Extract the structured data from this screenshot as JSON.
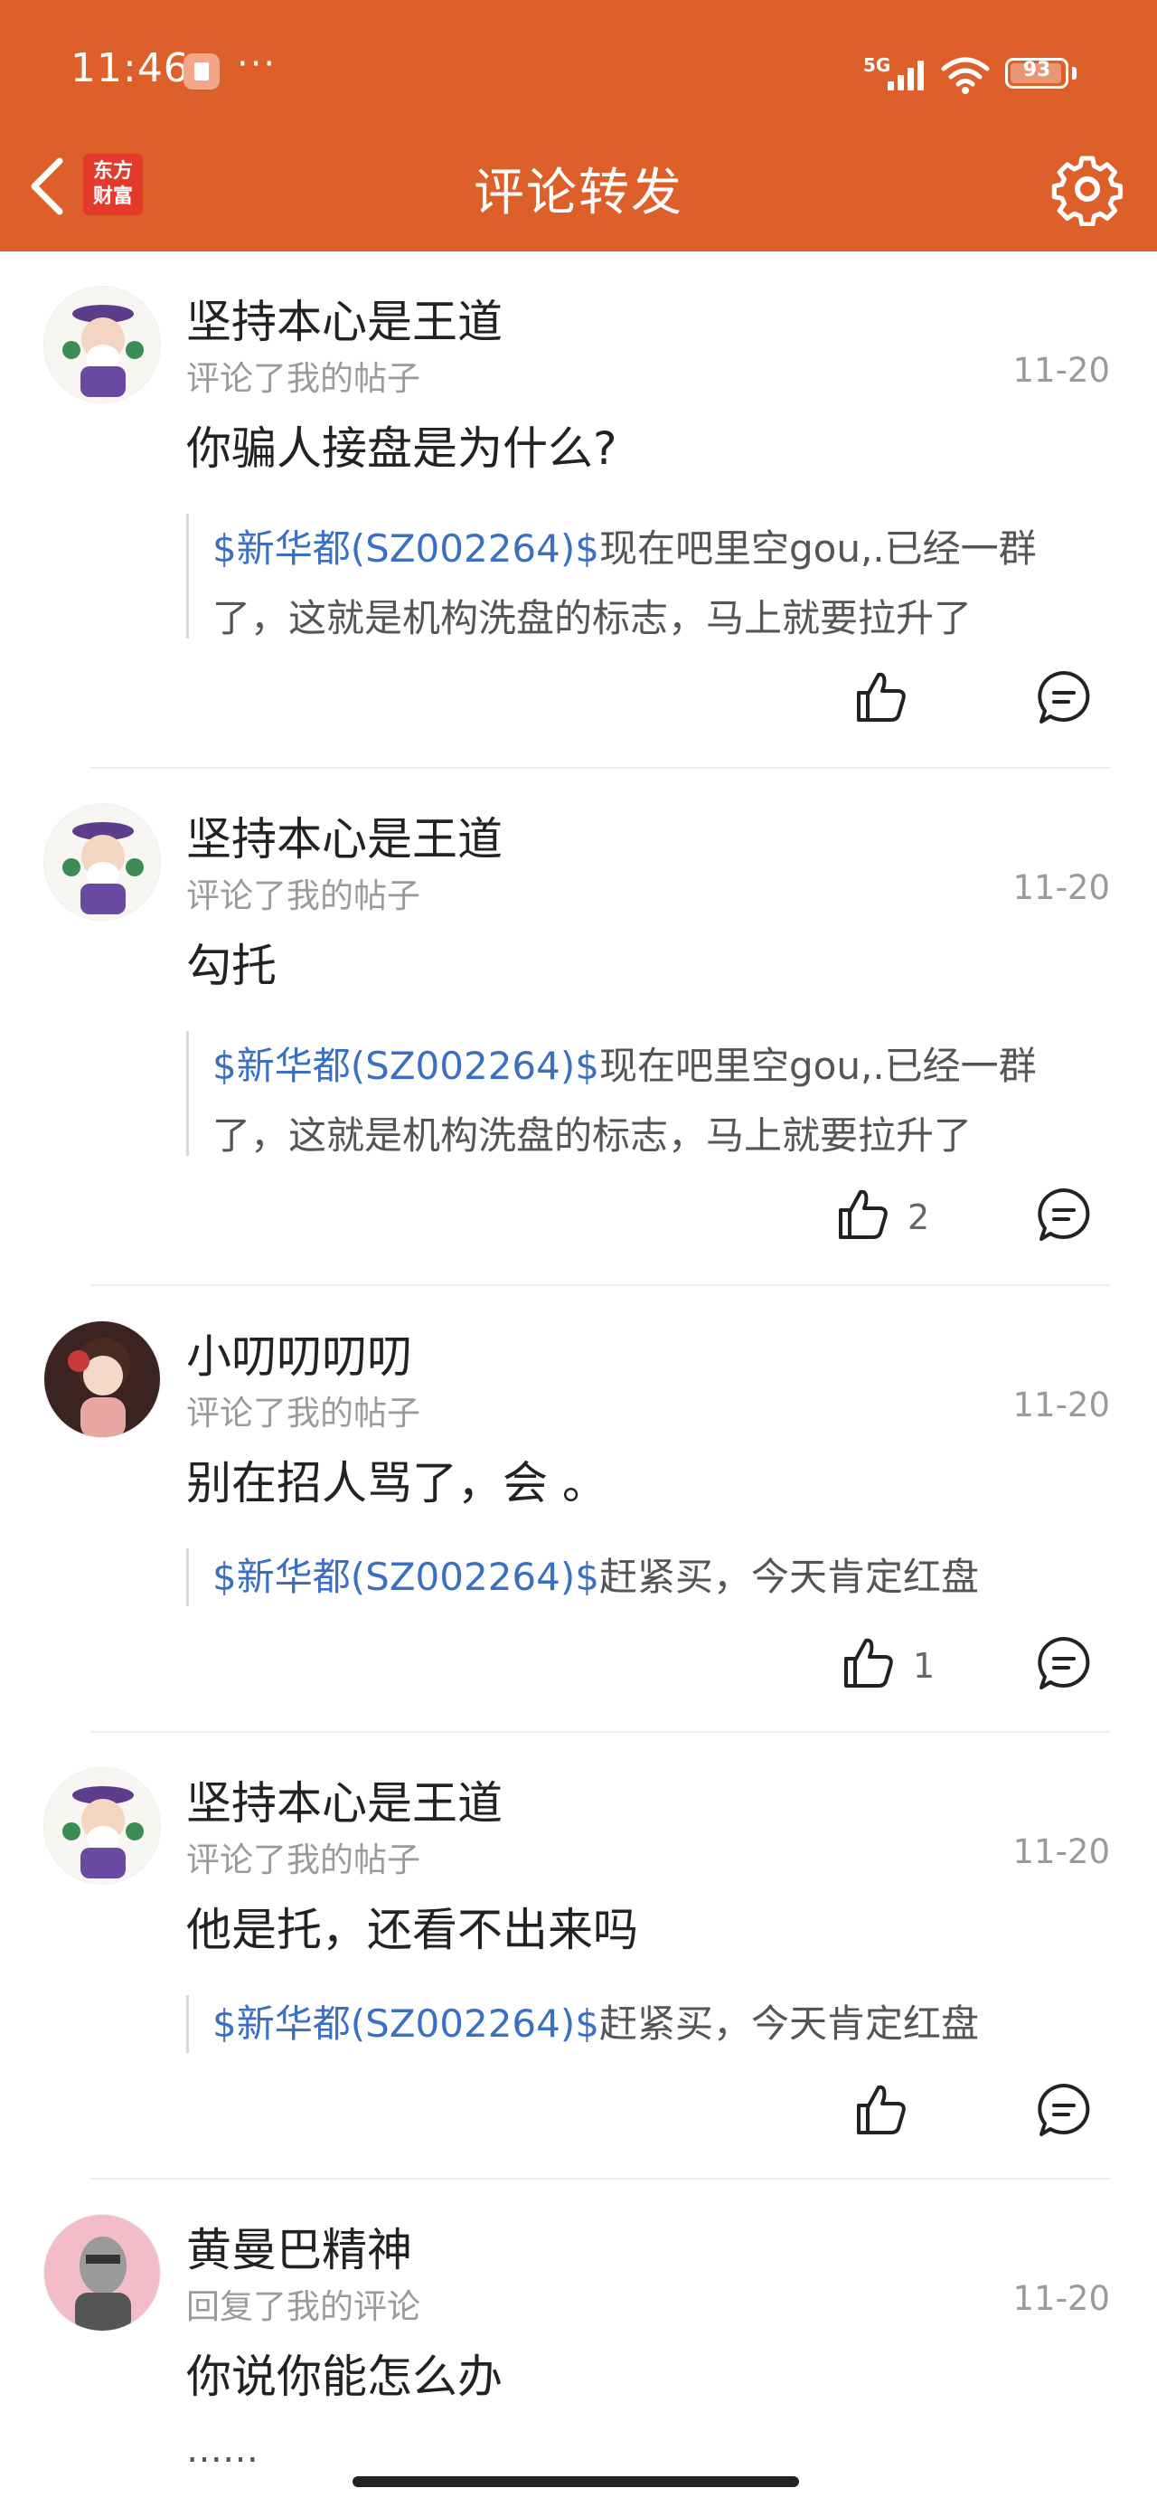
{
  "status_bar": {
    "time": "11:46",
    "dots": "···",
    "network": "5G",
    "battery": "93"
  },
  "header": {
    "title": "评论转发",
    "logo_line1": "东方",
    "logo_line2": "财富"
  },
  "icons": {
    "back": "chevron-left-icon",
    "settings": "gear-icon",
    "like": "thumbs-up-icon",
    "comment": "comment-bubble-icon"
  },
  "colors": {
    "brand": "#dd5f29",
    "link": "#3a6fc4",
    "muted": "#9a9a9a"
  },
  "items": [
    {
      "user": "坚持本心是王道",
      "action": "评论了我的帖子",
      "date": "11-20",
      "content": "你骗人接盘是为什么?",
      "quote_stock": "$新华都(SZ002264)$",
      "quote_line1": "现在吧里空gou,.已经一群",
      "quote_line2": "了，这就是机构洗盘的标志，马上就要拉升了",
      "likes": ""
    },
    {
      "user": "坚持本心是王道",
      "action": "评论了我的帖子",
      "date": "11-20",
      "content": "勾托",
      "quote_stock": "$新华都(SZ002264)$",
      "quote_line1": "现在吧里空gou,.已经一群",
      "quote_line2": "了，这就是机构洗盘的标志，马上就要拉升了",
      "likes": "2"
    },
    {
      "user": "小叨叨叨叨",
      "action": "评论了我的帖子",
      "date": "11-20",
      "content": "别在招人骂了，会 。",
      "quote_stock": "$新华都(SZ002264)$",
      "quote_line1": "赶紧买，今天肯定红盘",
      "likes": "1"
    },
    {
      "user": "坚持本心是王道",
      "action": "评论了我的帖子",
      "date": "11-20",
      "content": "他是托，还看不出来吗",
      "quote_stock": "$新华都(SZ002264)$",
      "quote_line1": "赶紧买，今天肯定红盘",
      "likes": ""
    },
    {
      "user": "黄曼巴精神",
      "action": "回复了我的评论",
      "date": "11-20",
      "content": "你说你能怎么办",
      "quote_line1": "……"
    }
  ]
}
